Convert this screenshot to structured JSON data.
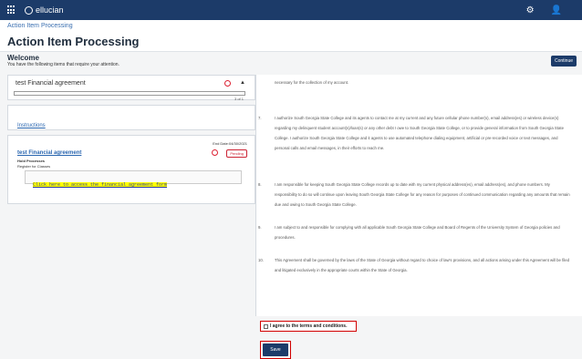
{
  "topbar": {
    "brand": "ellucian",
    "settings_icon": "gear-icon",
    "user_icon": "user-icon"
  },
  "breadcrumb": "Action Item Processing",
  "page_title": "Action Item Processing",
  "welcome": {
    "heading": "Welcome",
    "subtitle": "You have the following items that require your attention.",
    "continue_label": "Continue"
  },
  "items": {
    "group_title": "test Financial agreement",
    "page_count": "3 of 1",
    "instructions": "Instructions",
    "end_date": "End Date:04/30/2021",
    "item_link": "test Financial agreement",
    "status": "Pending",
    "hold": "Hold Processes",
    "hold_sub": "Register for Classes",
    "agreement_link": "Click here to access the financial agreement form"
  },
  "document": {
    "lead": "necessary for the collection of my account.",
    "clauses": [
      {
        "n": "7.",
        "text": "I authorize South Georgia State College and its agents to contact me at my current and any future cellular phone number(s), email address(es) or wireless device(s) regarding my delinquent student account(s)/loan(s) or any other debt I owe to South Georgia State College, or to provide general information from South Georgia State College. I authorize South Georgia State College and it agents to use automated telephone dialing equipment, artificial or pre-recorded voice or text messages, and personal calls and email messages, in their efforts to reach me."
      },
      {
        "n": "8.",
        "text": "I am responsible for keeping South Georgia State College records up to date with my current physical address(es), email address(es), and phone numbers. My responsibility to do so will continue upon leaving South Georgia State College for any reason for purposes of continued communication regarding any amounts that remain due and owing to South Georgia State College."
      },
      {
        "n": "9.",
        "text": "I am subject to and responsible for complying with all applicable South Georgia State College and Board of Regents of the University System of Georgia policies and procedures."
      },
      {
        "n": "10.",
        "text": "This Agreement shall be governed by the laws of the State of Georgia without regard to choice of law's provisions, and all actions arising under this Agreement will be filed and litigated exclusively in the appropriate courts within the State of Georgia."
      }
    ],
    "agree_label": "I agree to the terms and conditions.",
    "save_label": "Save"
  }
}
